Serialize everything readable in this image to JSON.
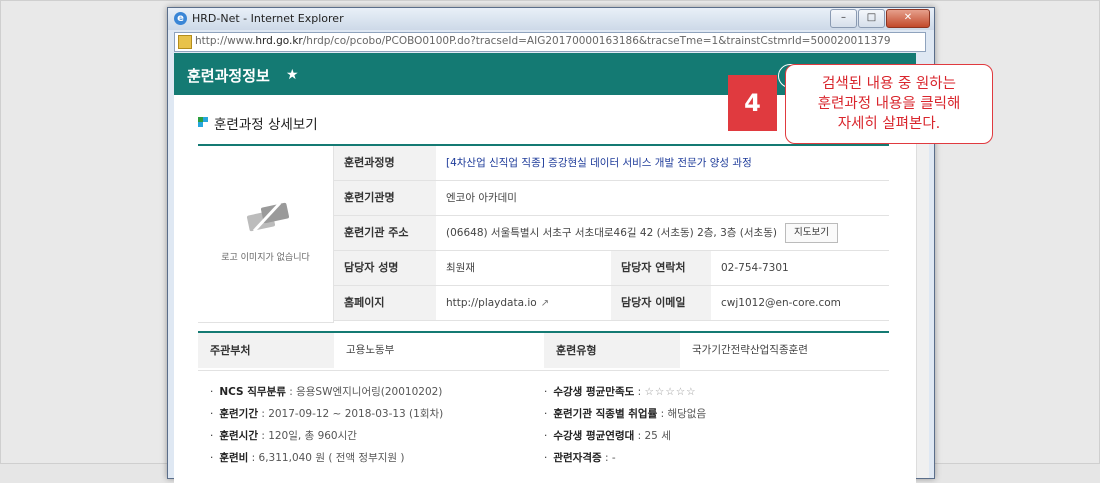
{
  "window": {
    "title": "HRD-Net - Internet Explorer",
    "url_prefix": "http://www.",
    "url_host": "hrd.go.kr",
    "url_path": "/hrdp/co/pcobo/PCOBO0100P.do?tracseId=AIG20170000163186&tracseTme=1&trainstCstmrId=500020011379",
    "minimize_icon": "minimize-icon",
    "maximize_icon": "maximize-icon",
    "close_icon": "close-icon"
  },
  "header": {
    "title": "훈련과정정보"
  },
  "section": {
    "heading": "훈련과정 상세보기"
  },
  "logo": {
    "no_logo_text": "로고 이미지가 없습니다"
  },
  "detail": {
    "course_label": "훈련과정명",
    "course_value": "[4차산업 신직업 직종] 증강현실 데이터 서비스 개발 전문가 양성 과정",
    "org_label": "훈련기관명",
    "org_value": "엔코아 아카데미",
    "address_label": "훈련기관 주소",
    "address_value": "(06648) 서울특별시 서초구 서초대로46길 42 (서초동) 2층, 3층 (서초동)",
    "map_button": "지도보기",
    "manager_label": "담당자 성명",
    "manager_value": "최원재",
    "contact_label": "담당자 연락처",
    "contact_value": "02-754-7301",
    "homepage_label": "홈페이지",
    "homepage_value": "http://playdata.io",
    "email_label": "담당자 이메일",
    "email_value": "cwj1012@en-core.com"
  },
  "org_row": {
    "dept_label": "주관부처",
    "dept_value": "고용노동부",
    "type_label": "훈련유형",
    "type_value": "국가기간전략산업직종훈련"
  },
  "bullets": {
    "ncs_key": "NCS 직무분류",
    "ncs_value": " : 응용SW엔지니어링(20010202)",
    "period_key": "훈련기간",
    "period_value": " : 2017-09-12 ~ 2018-03-13 (1회차)",
    "hours_key": "훈련시간",
    "hours_value": " : 120일, 총 960시간",
    "cost_key": "훈련비",
    "cost_value": " : 6,311,040 원 ( 전액 정부지원 )",
    "satisfaction_key": "수강생 평균만족도",
    "satisfaction_value": " : ",
    "satisfaction_stars": "☆☆☆☆☆",
    "employment_key": "훈련기관 직종별 취업률",
    "employment_value": " : 해당없음",
    "age_key": "수강생 평균연령대",
    "age_value": " : 25 세",
    "cert_key": "관련자격증",
    "cert_value": " : -"
  },
  "callout": {
    "step": "4",
    "line1": "검색된 내용 중 원하는",
    "line2": "훈련과정 내용을 클릭해",
    "line3": "자세히 살펴본다."
  }
}
